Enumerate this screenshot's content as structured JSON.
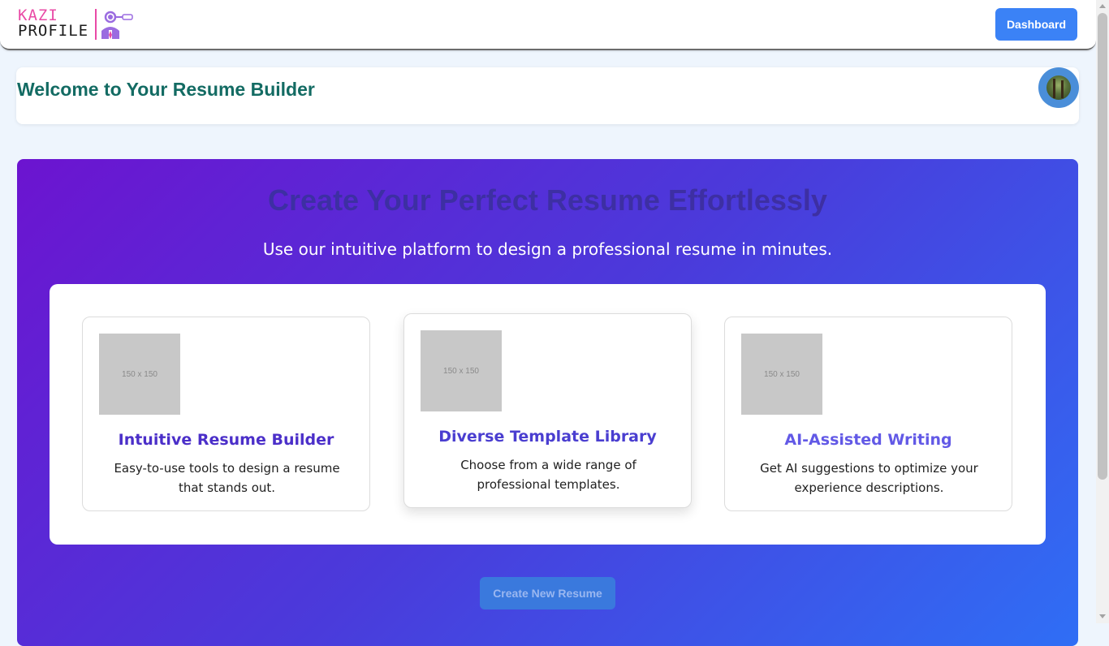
{
  "nav": {
    "logo": {
      "line1": "KAZI",
      "line2": "PROFILE"
    },
    "dashboard_label": "Dashboard"
  },
  "welcome": {
    "title": "Welcome to Your Resume Builder"
  },
  "hero": {
    "title": "Create Your Perfect Resume Effortlessly",
    "subtitle": "Use our intuitive platform to design a professional resume in minutes.",
    "features": [
      {
        "image_label": "150 x 150",
        "title": "Intuitive Resume Builder",
        "description": "Easy-to-use tools to design a resume that stands out.",
        "title_color": "#4b2fc9"
      },
      {
        "image_label": "150 x 150",
        "title": "Diverse Template Library",
        "description": "Choose from a wide range of professional templates.",
        "title_color": "#4a3ed0"
      },
      {
        "image_label": "150 x 150",
        "title": "AI-Assisted Writing",
        "description": "Get AI suggestions to optimize your experience descriptions.",
        "title_color": "#6259e6"
      }
    ],
    "cta_label": "Create New Resume"
  },
  "colors": {
    "accent": "#3b82f6",
    "welcome_title": "#136b63",
    "hero_gradient_start": "#6c14d0",
    "hero_gradient_end": "#2f6ef5"
  }
}
